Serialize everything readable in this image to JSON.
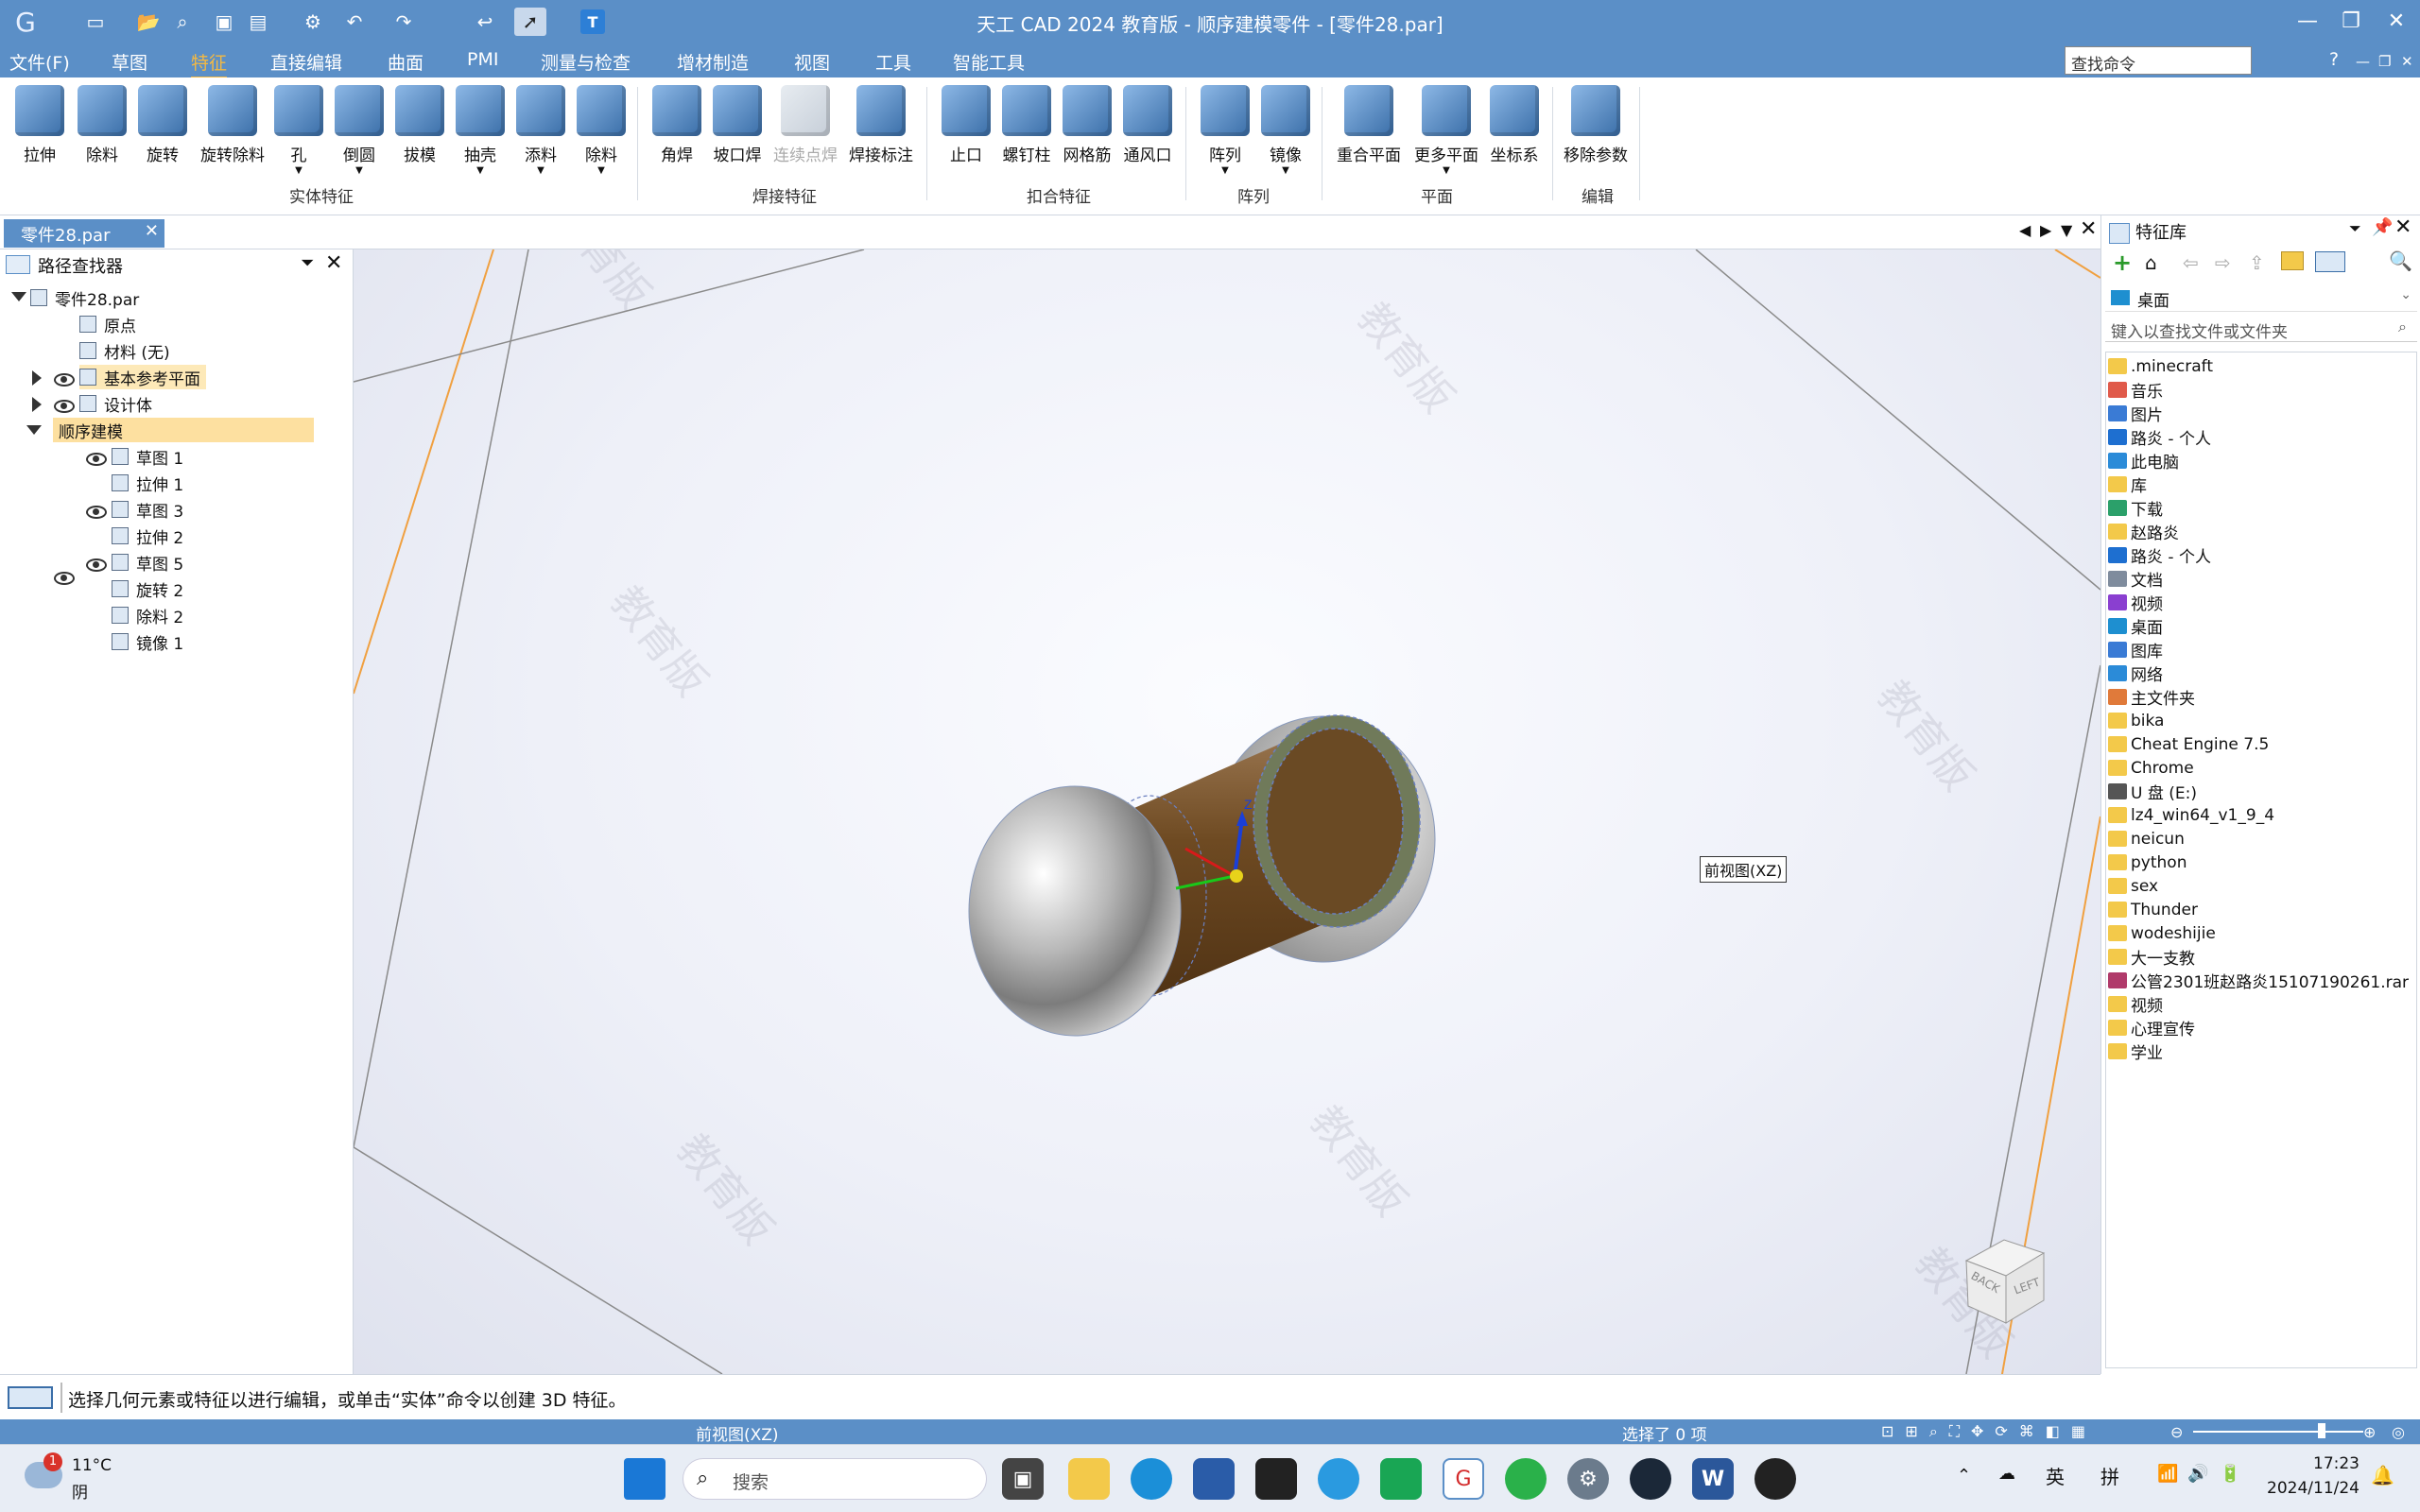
{
  "window": {
    "title": "天工 CAD 2024 教育版 - 顺序建模零件 - [零件28.par]"
  },
  "menubar": {
    "items": [
      "文件(F)",
      "草图",
      "特征",
      "直接编辑",
      "曲面",
      "PMI",
      "测量与检查",
      "增材制造",
      "视图",
      "工具",
      "智能工具"
    ],
    "active": "特征",
    "search_placeholder": "查找命令",
    "help": "?"
  },
  "ribbon": {
    "solid": {
      "label": "实体特征",
      "buttons": [
        "拉伸",
        "除料",
        "旋转",
        "旋转除料",
        "孔",
        "倒圆",
        "拔模",
        "抽壳",
        "添料",
        "除料"
      ]
    },
    "weld": {
      "label": "焊接特征",
      "buttons": [
        "角焊",
        "坡口焊",
        "连续点焊",
        "焊接标注"
      ]
    },
    "snap": {
      "label": "扣合特征",
      "buttons": [
        "止口",
        "螺钉柱",
        "网格筋",
        "通风口"
      ]
    },
    "pattern": {
      "label": "阵列",
      "buttons": [
        "阵列",
        "镜像"
      ]
    },
    "plane": {
      "label": "平面",
      "buttons": [
        "重合平面",
        "更多平面",
        "坐标系"
      ]
    },
    "edit": {
      "label": "编辑",
      "buttons": [
        "移除参数"
      ]
    }
  },
  "doc_tab": {
    "label": "零件28.par"
  },
  "pathfinder": {
    "title": "路径查找器",
    "root": "零件28.par",
    "items": [
      {
        "label": "原点"
      },
      {
        "label": "材料 (无)"
      },
      {
        "label": "基本参考平面"
      },
      {
        "label": "设计体"
      },
      {
        "label": "顺序建模"
      }
    ],
    "features": [
      "草图 1",
      "拉伸 1",
      "草图 3",
      "拉伸 2",
      "草图 5",
      "旋转 2",
      "除料 2",
      "镜像 1"
    ]
  },
  "viewport": {
    "watermark": "教育版",
    "view_tooltip": "前视图(XZ)",
    "view_cube": {
      "back": "BACK",
      "left": "LEFT"
    }
  },
  "feature_library": {
    "title": "特征库",
    "location": "桌面",
    "search_placeholder": "键入以查找文件或文件夹",
    "items": [
      {
        "name": ".minecraft",
        "color": "#f3c94a"
      },
      {
        "name": "音乐",
        "color": "#e05a4a"
      },
      {
        "name": "图片",
        "color": "#3a7bd5"
      },
      {
        "name": "路炎 - 个人",
        "color": "#1e6fd0"
      },
      {
        "name": "此电脑",
        "color": "#2b8bd8"
      },
      {
        "name": "库",
        "color": "#f3c94a"
      },
      {
        "name": "下载",
        "color": "#2ba06a"
      },
      {
        "name": "赵路炎",
        "color": "#f3c94a"
      },
      {
        "name": "路炎 - 个人",
        "color": "#1e6fd0"
      },
      {
        "name": "文档",
        "color": "#7f8c9d"
      },
      {
        "name": "视频",
        "color": "#8a3fd0"
      },
      {
        "name": "桌面",
        "color": "#1e8fd0"
      },
      {
        "name": "图库",
        "color": "#3a7bd5"
      },
      {
        "name": "网络",
        "color": "#2b8bd8"
      },
      {
        "name": "主文件夹",
        "color": "#e07a3a"
      },
      {
        "name": "bika",
        "color": "#f3c94a"
      },
      {
        "name": "Cheat Engine 7.5",
        "color": "#f3c94a"
      },
      {
        "name": "Chrome",
        "color": "#f3c94a"
      },
      {
        "name": "U 盘 (E:)",
        "color": "#555555"
      },
      {
        "name": "lz4_win64_v1_9_4",
        "color": "#f3c94a"
      },
      {
        "name": "neicun",
        "color": "#f3c94a"
      },
      {
        "name": "python",
        "color": "#f3c94a"
      },
      {
        "name": "sex",
        "color": "#f3c94a"
      },
      {
        "name": "Thunder",
        "color": "#f3c94a"
      },
      {
        "name": "wodeshijie",
        "color": "#f3c94a"
      },
      {
        "name": "大一支教",
        "color": "#f3c94a"
      },
      {
        "name": "公管2301班赵路炎15107190261.rar",
        "color": "#b03a6a"
      },
      {
        "name": "视频",
        "color": "#f3c94a"
      },
      {
        "name": "心理宣传",
        "color": "#f3c94a"
      },
      {
        "name": "学业",
        "color": "#f3c94a"
      }
    ]
  },
  "command_bar": {
    "prompt": "选择几何元素或特征以进行编辑，或单击“实体”命令以创建 3D 特征。"
  },
  "status_bar": {
    "view": "前视图(XZ)",
    "selection": "选择了 0 项"
  },
  "taskbar": {
    "weather_temp": "11°C",
    "weather_desc": "阴",
    "weather_badge": "1",
    "search_placeholder": "搜索",
    "ime_lang": "英",
    "ime_mode": "拼",
    "time": "17:23",
    "date": "2024/11/24"
  }
}
